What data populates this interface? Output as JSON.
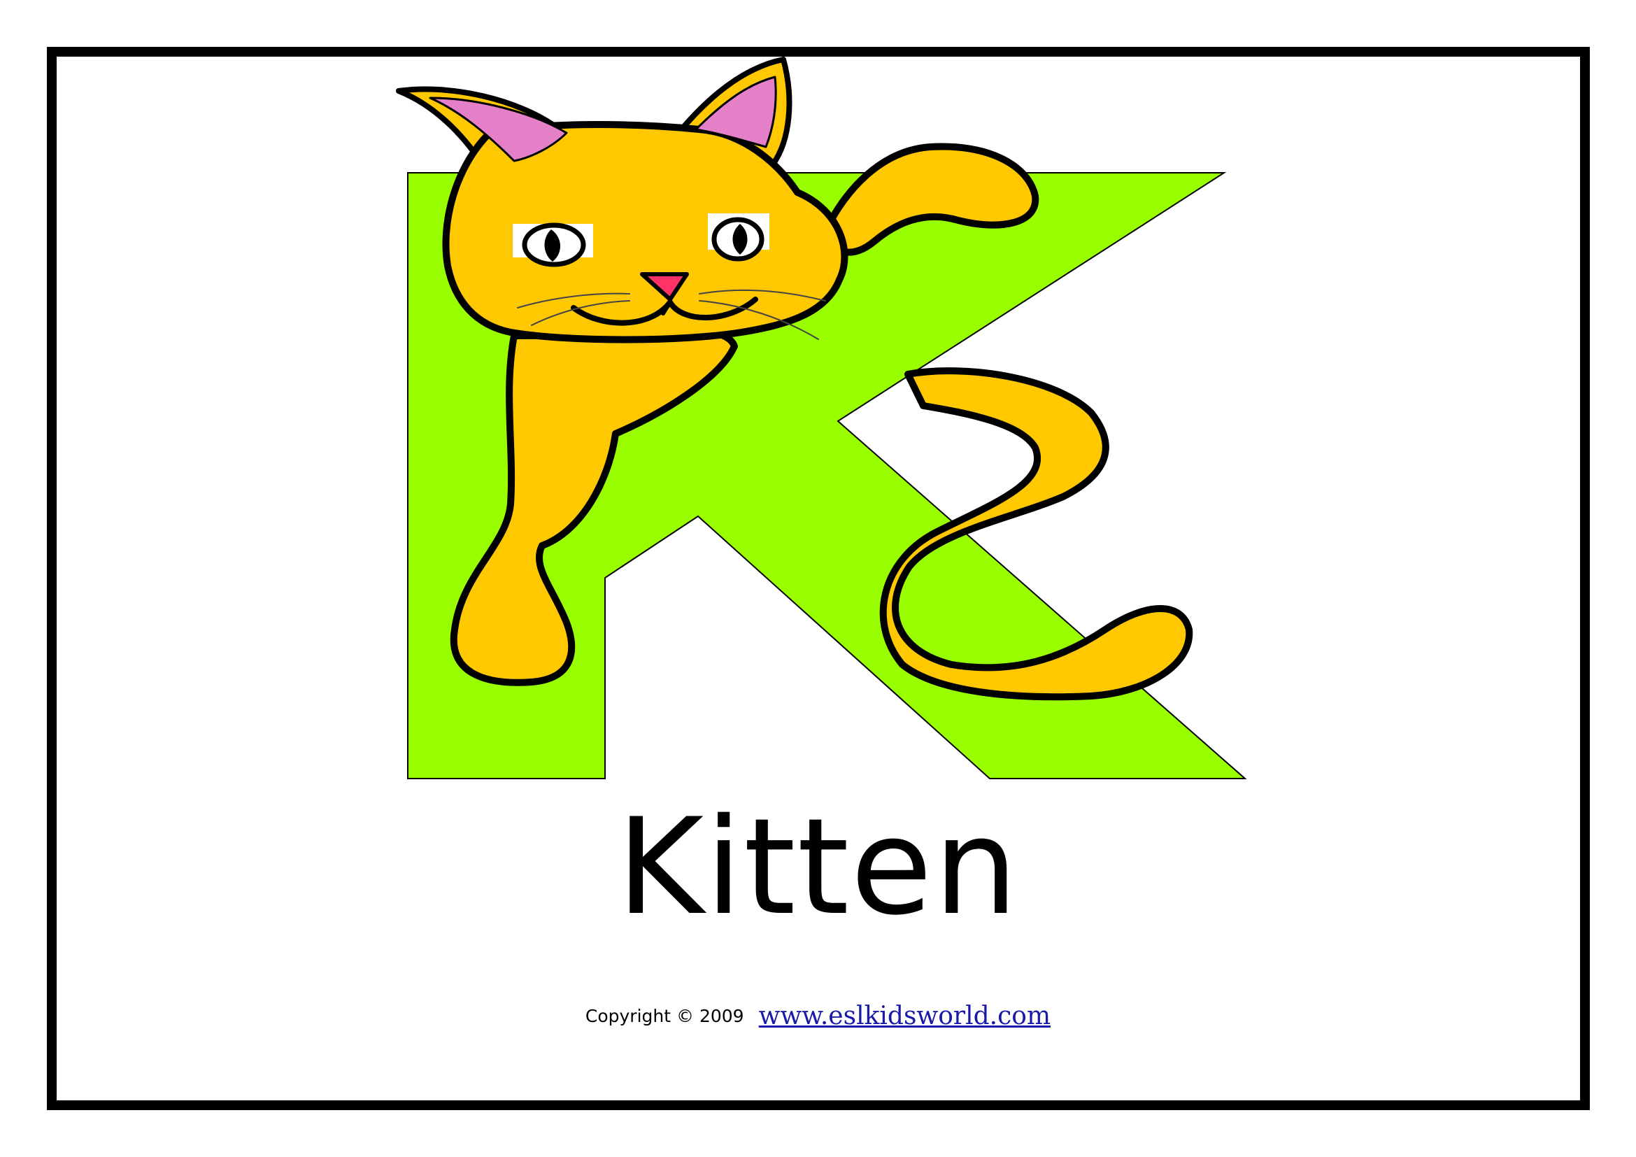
{
  "card": {
    "word": "Kitten",
    "copyright_text": "Copyright © 2009",
    "site_link": "www.eslkidsworld.com"
  },
  "colors": {
    "frame": "#000000",
    "letter_k": "#99ff00",
    "kitten_fur": "#ffc800",
    "ear_inner": "#e47fc8",
    "nose": "#ff3366",
    "link": "#1a1aa8"
  },
  "illustration": {
    "letter": "K",
    "subject": "kitten"
  }
}
